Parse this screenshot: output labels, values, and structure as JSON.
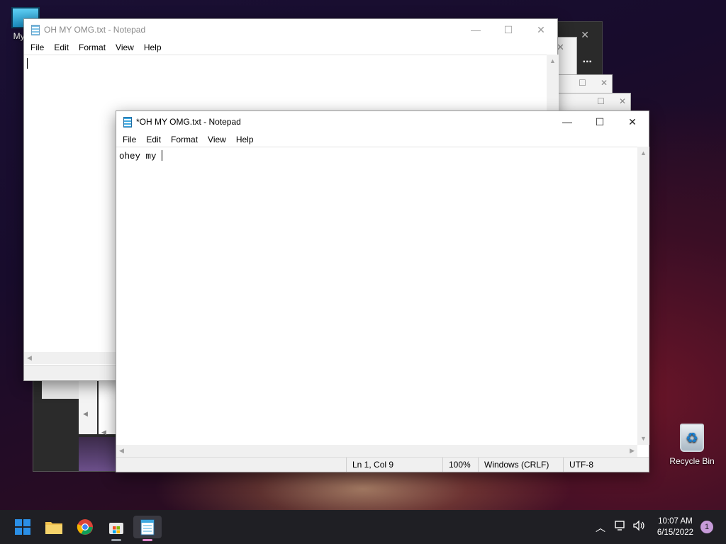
{
  "desktop": {
    "icons": [
      {
        "label": "My Co"
      },
      {
        "label": "Recycle Bin"
      }
    ]
  },
  "window_back": {
    "title": "OH MY OMG.txt - Notepad",
    "menu": [
      "File",
      "Edit",
      "Format",
      "View",
      "Help"
    ],
    "content": ""
  },
  "window_front": {
    "title": "*OH MY OMG.txt - Notepad",
    "menu": [
      "File",
      "Edit",
      "Format",
      "View",
      "Help"
    ],
    "content": "ohey my ",
    "status": {
      "position": "Ln 1, Col 9",
      "zoom": "100%",
      "line_ending": "Windows (CRLF)",
      "encoding": "UTF-8"
    }
  },
  "ghost_overflow": "...",
  "taskbar": {
    "apps": [
      "windows-start-icon",
      "file-explorer-icon",
      "chrome-icon",
      "store-icon",
      "notepad-icon"
    ],
    "time": "10:07 AM",
    "date": "6/15/2022",
    "notification_count": "1"
  },
  "colors": {
    "taskbar_bg": "#1f1f24",
    "start_blue": "#2b8fe6",
    "folder_yellow": "#f2c14e",
    "notif_badge": "#c79bd9"
  }
}
